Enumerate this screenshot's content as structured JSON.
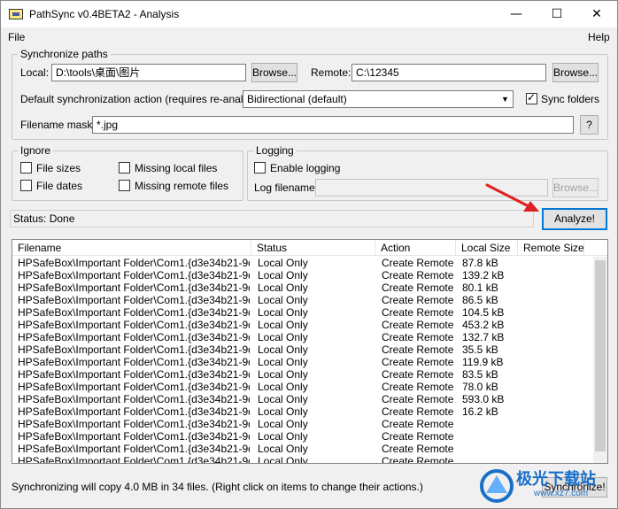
{
  "window": {
    "title": "PathSync v0.4BETA2 - Analysis",
    "minimize": "—",
    "maximize": "☐",
    "close": "✕"
  },
  "menu": {
    "file": "File",
    "help": "Help"
  },
  "sync_paths": {
    "group_label": "Synchronize paths",
    "local_label": "Local:",
    "local_value": "D:\\tools\\桌面\\图片",
    "browse_local": "Browse...",
    "remote_label": "Remote:",
    "remote_value": "C:\\12345",
    "browse_remote": "Browse...",
    "action_label": "Default synchronization action (requires re-analyze):",
    "action_value": "Bidirectional (default)",
    "sync_folders_label": "Sync folders",
    "sync_folders_checked": true,
    "mask_label": "Filename mask:",
    "mask_value": "*.jpg",
    "mask_help": "?"
  },
  "ignore": {
    "group_label": "Ignore",
    "file_sizes": "File sizes",
    "file_dates": "File dates",
    "missing_local": "Missing local files",
    "missing_remote": "Missing remote files"
  },
  "logging": {
    "group_label": "Logging",
    "enable_logging": "Enable logging",
    "log_filename_label": "Log filename:",
    "log_filename_value": "",
    "browse": "Browse..."
  },
  "status": {
    "text": "Status: Done",
    "analyze_button": "Analyze!"
  },
  "table": {
    "columns": [
      "Filename",
      "Status",
      "Action",
      "Local Size",
      "Remote Size"
    ],
    "rows": [
      {
        "filename": "HPSafeBox\\Important Folder\\Com1.{d3e34b21-9d75-...",
        "status": "Local Only",
        "action": "Create Remote",
        "local_size": "87.8 kB",
        "remote_size": ""
      },
      {
        "filename": "HPSafeBox\\Important Folder\\Com1.{d3e34b21-9d75-...",
        "status": "Local Only",
        "action": "Create Remote",
        "local_size": "139.2 kB",
        "remote_size": ""
      },
      {
        "filename": "HPSafeBox\\Important Folder\\Com1.{d3e34b21-9d75-...",
        "status": "Local Only",
        "action": "Create Remote",
        "local_size": "80.1 kB",
        "remote_size": ""
      },
      {
        "filename": "HPSafeBox\\Important Folder\\Com1.{d3e34b21-9d75-...",
        "status": "Local Only",
        "action": "Create Remote",
        "local_size": "86.5 kB",
        "remote_size": ""
      },
      {
        "filename": "HPSafeBox\\Important Folder\\Com1.{d3e34b21-9d75-...",
        "status": "Local Only",
        "action": "Create Remote",
        "local_size": "104.5 kB",
        "remote_size": ""
      },
      {
        "filename": "HPSafeBox\\Important Folder\\Com1.{d3e34b21-9d75-...",
        "status": "Local Only",
        "action": "Create Remote",
        "local_size": "453.2 kB",
        "remote_size": ""
      },
      {
        "filename": "HPSafeBox\\Important Folder\\Com1.{d3e34b21-9d75-...",
        "status": "Local Only",
        "action": "Create Remote",
        "local_size": "132.7 kB",
        "remote_size": ""
      },
      {
        "filename": "HPSafeBox\\Important Folder\\Com1.{d3e34b21-9d75-...",
        "status": "Local Only",
        "action": "Create Remote",
        "local_size": "35.5 kB",
        "remote_size": ""
      },
      {
        "filename": "HPSafeBox\\Important Folder\\Com1.{d3e34b21-9d75-...",
        "status": "Local Only",
        "action": "Create Remote",
        "local_size": "119.9 kB",
        "remote_size": ""
      },
      {
        "filename": "HPSafeBox\\Important Folder\\Com1.{d3e34b21-9d75-...",
        "status": "Local Only",
        "action": "Create Remote",
        "local_size": "83.5 kB",
        "remote_size": ""
      },
      {
        "filename": "HPSafeBox\\Important Folder\\Com1.{d3e34b21-9d75-...",
        "status": "Local Only",
        "action": "Create Remote",
        "local_size": "78.0 kB",
        "remote_size": ""
      },
      {
        "filename": "HPSafeBox\\Important Folder\\Com1.{d3e34b21-9d75-...",
        "status": "Local Only",
        "action": "Create Remote",
        "local_size": "593.0 kB",
        "remote_size": ""
      },
      {
        "filename": "HPSafeBox\\Important Folder\\Com1.{d3e34b21-9d75-...",
        "status": "Local Only",
        "action": "Create Remote",
        "local_size": "16.2 kB",
        "remote_size": ""
      },
      {
        "filename": "HPSafeBox\\Important Folder\\Com1.{d3e34b21-9d75-...",
        "status": "Local Only",
        "action": "Create Remote",
        "local_size": "",
        "remote_size": ""
      },
      {
        "filename": "HPSafeBox\\Important Folder\\Com1.{d3e34b21-9d75-...",
        "status": "Local Only",
        "action": "Create Remote",
        "local_size": "",
        "remote_size": ""
      },
      {
        "filename": "HPSafeBox\\Important Folder\\Com1.{d3e34b21-9d75-...",
        "status": "Local Only",
        "action": "Create Remote",
        "local_size": "",
        "remote_size": ""
      },
      {
        "filename": "HPSafeBox\\Important Folder\\Com1.{d3e34b21-9d75-...",
        "status": "Local Only",
        "action": "Create Remote",
        "local_size": "",
        "remote_size": ""
      }
    ]
  },
  "footer": {
    "summary": "Synchronizing will copy 4.0 MB in 34 files. (Right click on items to change their actions.)",
    "synchronize_button": "Synchronize!"
  },
  "watermark": {
    "text": "极光下载站",
    "url": "www.xz7.com"
  },
  "colors": {
    "arrow": "#e02020",
    "button_focus": "#0078d7",
    "watermark": "#1a6fc9"
  }
}
